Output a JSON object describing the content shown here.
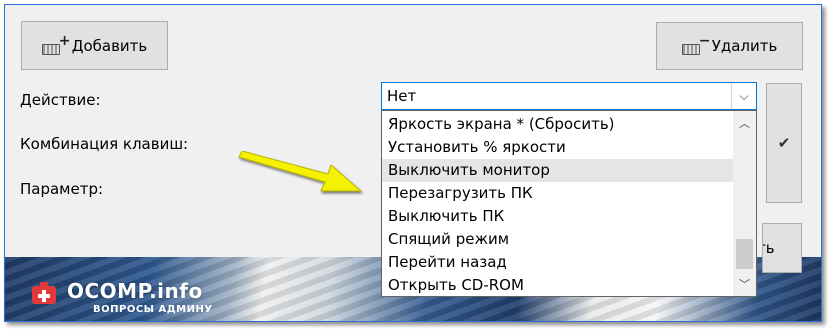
{
  "toolbar": {
    "add_label": "Добавить",
    "delete_label": "Удалить"
  },
  "form": {
    "action_label": "Действие:",
    "combo_label": "Комбинация клавиш:",
    "param_label": "Параметр:"
  },
  "action_select": {
    "value": "Нет",
    "options": [
      "Яркость экрана * (Сбросить)",
      "Установить % яркости",
      "Выключить монитор",
      "Перезагрузить ПК",
      "Выключить ПК",
      "Спящий режим",
      "Перейти назад",
      "Открыть CD-ROM"
    ],
    "highlighted_index": 2
  },
  "partial_button_label": "ть",
  "watermark": {
    "title": "OCOMP.info",
    "subtitle": "ВОПРОСЫ АДМИНУ"
  },
  "colors": {
    "accent": "#0078d7",
    "frame_border": "#2d6fd6",
    "pointer_arrow": "#f4f200"
  }
}
